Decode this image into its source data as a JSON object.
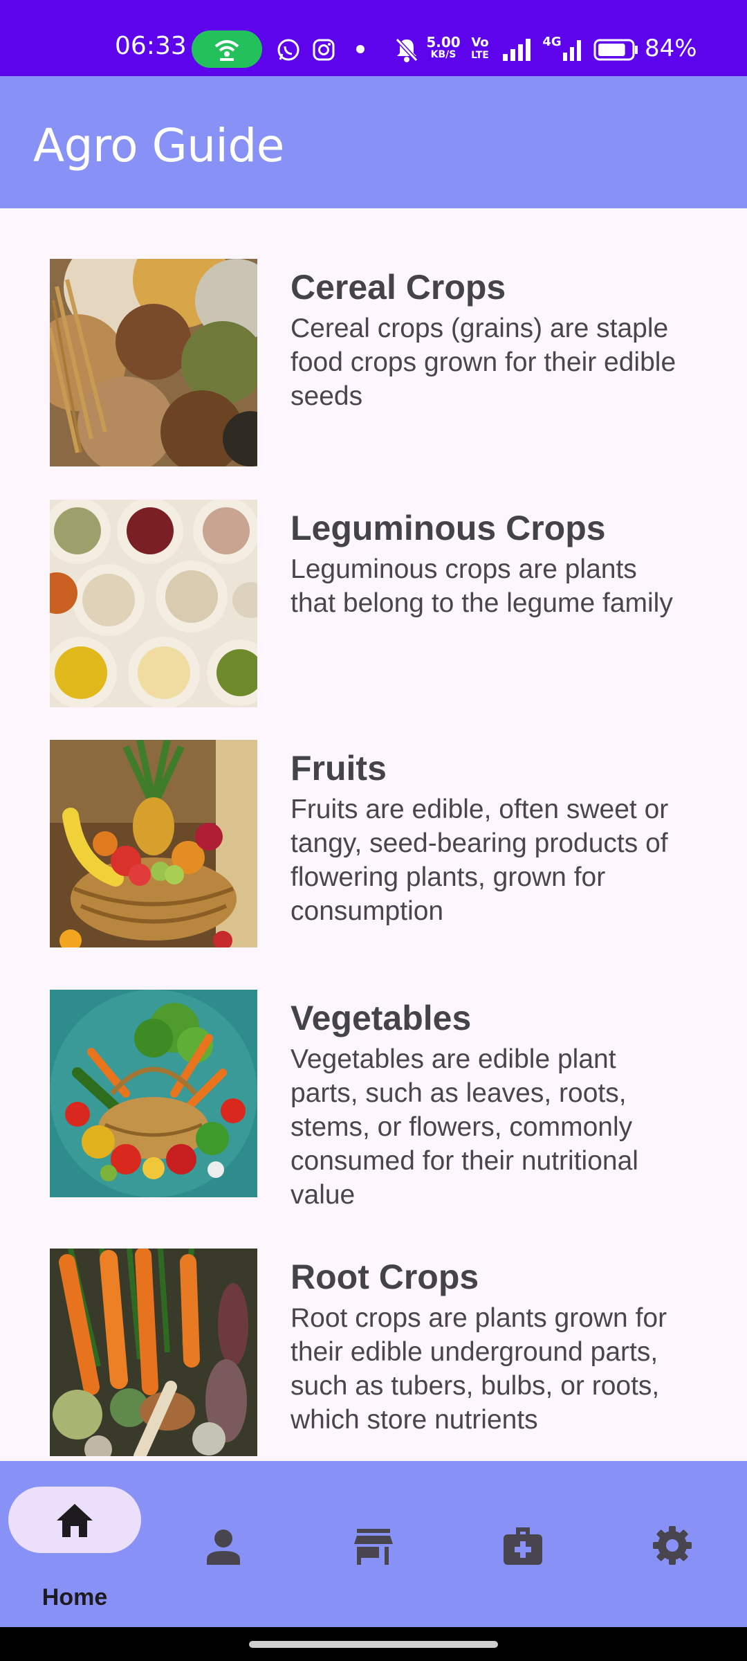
{
  "status_bar": {
    "time": "06:33",
    "net_speed_value": "5.00",
    "net_speed_unit": "KB/S",
    "volte_top": "Vo",
    "volte_bottom": "LTE",
    "network_type": "4G",
    "battery_percent": "84%",
    "battery_level": 0.84,
    "icons": [
      "hotspot-icon",
      "whatsapp-icon",
      "instagram-icon",
      "notification-dot",
      "mute-icon",
      "signal-icon",
      "battery-icon"
    ]
  },
  "app_bar": {
    "title": "Agro Guide"
  },
  "categories": [
    {
      "title": "Cereal Crops",
      "description": "Cereal crops (grains) are staple food crops grown for their edible seeds",
      "image": "cereal-grains-image"
    },
    {
      "title": "Leguminous Crops",
      "description": "Leguminous crops are plants that belong to the legume family",
      "image": "legume-sacks-image"
    },
    {
      "title": "Fruits",
      "description": "Fruits are edible, often sweet or tangy, seed-bearing products of flowering plants, grown for consumption",
      "image": "fruit-basket-image"
    },
    {
      "title": "Vegetables",
      "description": "Vegetables are edible plant parts, such as leaves, roots, stems, or flowers, commonly consumed for their nutritional value",
      "image": "vegetable-basket-image"
    },
    {
      "title": "Root Crops",
      "description": "Root crops are plants grown for their edible underground parts, such as tubers, bulbs, or roots, which store nutrients",
      "image": "root-vegetables-image"
    }
  ],
  "bottom_nav": {
    "selected": "home",
    "items": [
      {
        "id": "home",
        "label": "Home",
        "icon": "home-icon"
      },
      {
        "id": "profile",
        "icon": "person-icon"
      },
      {
        "id": "store",
        "icon": "store-icon"
      },
      {
        "id": "health",
        "icon": "medical-kit-icon"
      },
      {
        "id": "settings",
        "icon": "gear-icon"
      }
    ]
  },
  "colors": {
    "status_bar": "#5e04ec",
    "app_bar": "#8892f6",
    "background": "#fdf6fd",
    "nav_indicator": "#ecdffb",
    "hotspot_pill": "#23c15b"
  }
}
